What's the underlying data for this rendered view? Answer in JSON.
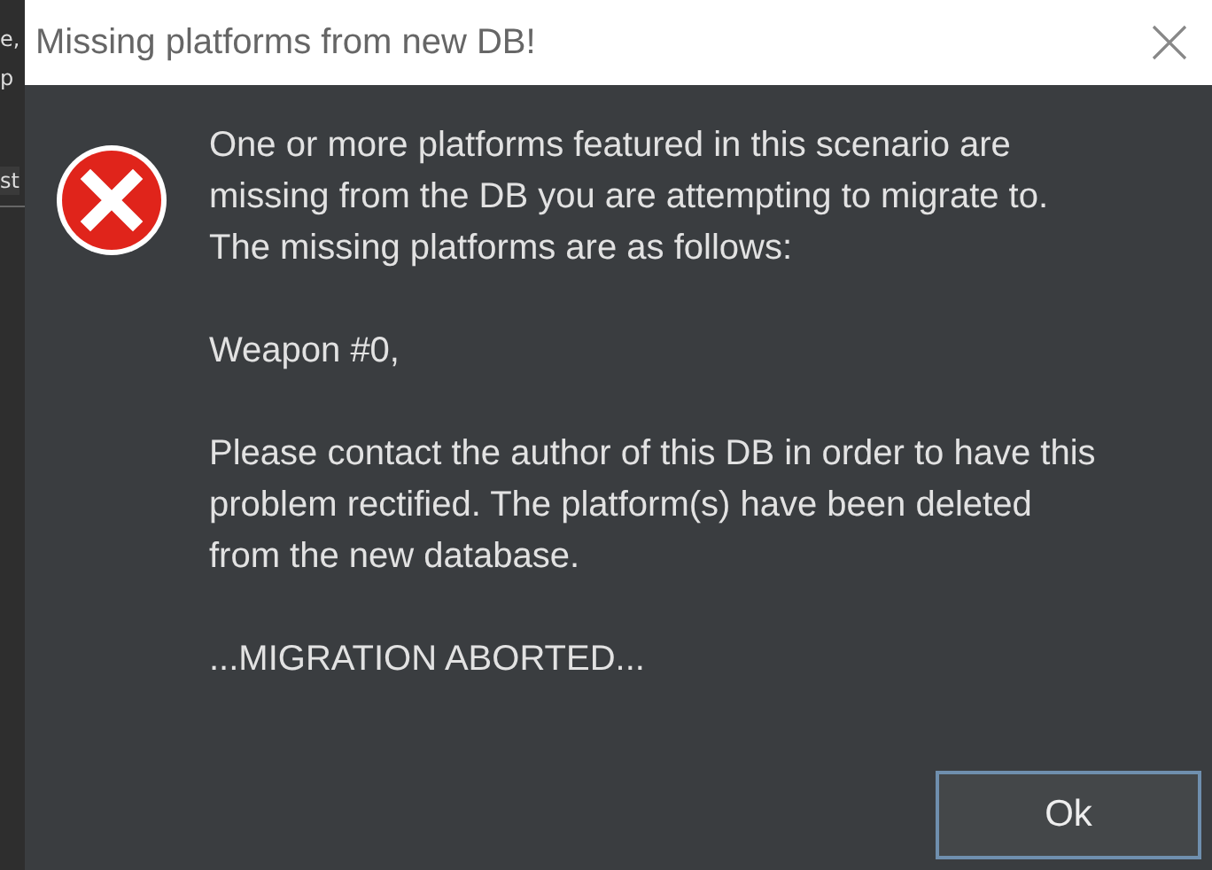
{
  "background_window": {
    "fragments": [
      "e,",
      "p",
      "st"
    ]
  },
  "dialog": {
    "title": "Missing platforms from new DB!",
    "paragraphs": [
      "One or more platforms featured in this scenario are missing from the DB you are attempting to migrate to. The missing platforms are as follows:",
      "Weapon #0,",
      "Please contact the author of this DB in order to have this problem rectified. The platform(s) have been deleted from the new database.",
      "...MIGRATION ABORTED..."
    ],
    "buttons": [
      "Ok"
    ]
  }
}
